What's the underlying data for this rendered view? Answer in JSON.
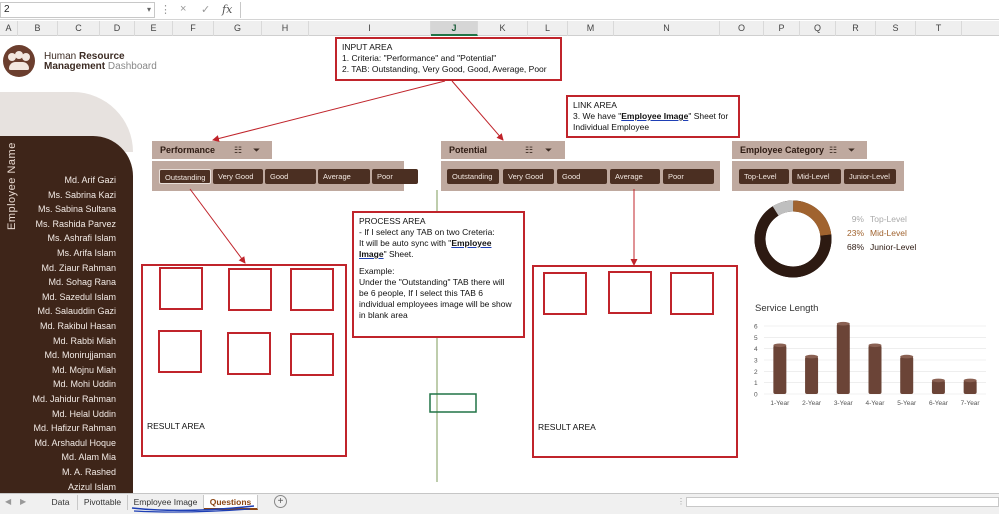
{
  "namebox": {
    "value": "2"
  },
  "formula": {
    "fx": "fx",
    "cancel": "×",
    "confirm": "✓"
  },
  "columns": [
    "A",
    "B",
    "C",
    "D",
    "E",
    "F",
    "G",
    "H",
    "I",
    "J",
    "K",
    "L",
    "M",
    "N",
    "O",
    "P",
    "Q",
    "R",
    "S",
    "T"
  ],
  "selected_column": "J",
  "brand": {
    "line1_a": "Human ",
    "line1_b": "Resource",
    "line2_a": "Management ",
    "line2_b": "Dashboard"
  },
  "sidebar": {
    "title": "Employee Name",
    "employees": [
      "Md. Arif Gazi",
      "Ms. Sabrina Kazi",
      "Ms. Sabina Sultana",
      "Ms. Rashida Parvez",
      "Ms. Ashrafi Islam",
      "Ms. Arifa Islam",
      "Md. Ziaur Rahman",
      "Md. Sohag Rana",
      "Md. Sazedul Islam",
      "Md. Salauddin Gazi",
      "Md. Rakibul Hasan",
      "Md. Rabbi Miah",
      "Md. Monirujjaman",
      "Md. Mojnu Miah",
      "Md. Mohi Uddin",
      "Md. Jahidur Rahman",
      "Md. Helal Uddin",
      "Md. Hafizur Rahman",
      "Md. Arshadul Hoque",
      "Md. Alam Mia",
      "M. A. Rashed",
      "Azizul Islam"
    ]
  },
  "slicers": {
    "performance": {
      "title": "Performance",
      "buttons": [
        "Outstanding",
        "Very Good",
        "Good",
        "Average",
        "Poor"
      ]
    },
    "potential": {
      "title": "Potential",
      "buttons": [
        "Outstanding",
        "Very Good",
        "Good",
        "Average",
        "Poor"
      ]
    },
    "category": {
      "title": "Employee Category",
      "buttons": [
        "Top-Level",
        "Mid-Level",
        "Junior-Level"
      ]
    }
  },
  "notes": {
    "input": {
      "title": "INPUT AREA",
      "line1": "1. Criteria: \"Performance\" and \"Potential\"",
      "line2": "2. TAB: Outstanding, Very Good, Good, Average, Poor"
    },
    "link": {
      "title": "LINK AREA",
      "line1_a": "3. We have \"",
      "line1_b": "Employee Image",
      "line1_c": "\" Sheet for",
      "line2": "Individual Employee"
    },
    "process": {
      "title": "PROCESS AREA",
      "line1": "- If I select any TAB on two Creteria:",
      "line2_a": "It will be auto sync with \"",
      "line2_b": "Employee",
      "line3_a": "Image",
      "line3_b": "\" Sheet.",
      "line4": "Example:",
      "line5": "Under the \"Outstanding\" TAB there will",
      "line6": "be 6 people, If I select this TAB 6",
      "line7": "individual employees image will be show",
      "line8": "in blank area"
    }
  },
  "result_label": "RESULT AREA",
  "donut": {
    "legend": [
      {
        "pct": "9%",
        "label": "Top-Level",
        "color": "#bfbfbf"
      },
      {
        "pct": "23%",
        "label": "Mid-Level",
        "color": "#a0632f"
      },
      {
        "pct": "68%",
        "label": "Junior-Level",
        "color": "#2d1a12"
      }
    ]
  },
  "chart_data": {
    "type": "bar",
    "title": "Service Length",
    "categories": [
      "1-Year",
      "2-Year",
      "3-Year",
      "4-Year",
      "5-Year",
      "6-Year",
      "7-Year"
    ],
    "values": [
      4.3,
      3.3,
      6.2,
      4.3,
      3.3,
      1.2,
      1.2
    ],
    "ylim": [
      0,
      6
    ],
    "yticks": [
      "0",
      "1",
      "2",
      "3",
      "4",
      "5",
      "6"
    ],
    "color": "#6b4437",
    "grid": true
  },
  "tabs": [
    "Data",
    "Pivottable",
    "Employee Image",
    "Questions"
  ],
  "active_tab": "Questions",
  "add_sheet": "+"
}
